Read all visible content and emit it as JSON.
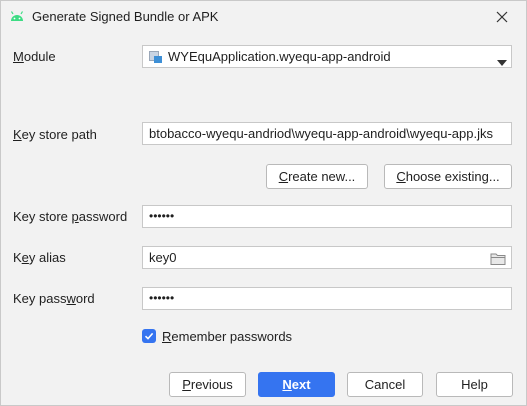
{
  "window": {
    "title": "Generate Signed Bundle or APK"
  },
  "form": {
    "module": {
      "label_mnemonic": "M",
      "label_rest": "odule",
      "value": "WYEquApplication.wyequ-app-android"
    },
    "key_store_path": {
      "label_mnemonic": "K",
      "label_rest": "ey store path",
      "value": "btobacco-wyequ-andriod\\wyequ-app-android\\wyequ-app.jks"
    },
    "create_new": {
      "mnemonic": "C",
      "rest": "reate new..."
    },
    "choose_existing": {
      "mnemonic": "C",
      "rest": "hoose existing..."
    },
    "key_store_password": {
      "label_pre": "Key store ",
      "label_mnemonic": "p",
      "label_rest": "assword",
      "value": "••••••"
    },
    "key_alias": {
      "label_pre": "K",
      "label_mnemonic": "e",
      "label_rest": "y alias",
      "value": "key0"
    },
    "key_password": {
      "label_pre": "Key pass",
      "label_mnemonic": "w",
      "label_rest": "ord",
      "value": "••••••"
    },
    "remember": {
      "mnemonic": "R",
      "rest": "emember passwords",
      "checked": true
    }
  },
  "buttons": {
    "previous": {
      "mnemonic": "P",
      "rest": "revious"
    },
    "next": {
      "mnemonic": "N",
      "rest": "ext"
    },
    "cancel": "Cancel",
    "help": "Help"
  },
  "colors": {
    "accent": "#3574f0",
    "android_green": "#3ddc84",
    "background": "#f2f2f2"
  },
  "icons": {
    "app": "android-icon",
    "close": "close-icon",
    "module": "module-icon",
    "dropdown": "chevron-down-icon",
    "folder": "folder-icon",
    "check": "checkmark-icon"
  }
}
